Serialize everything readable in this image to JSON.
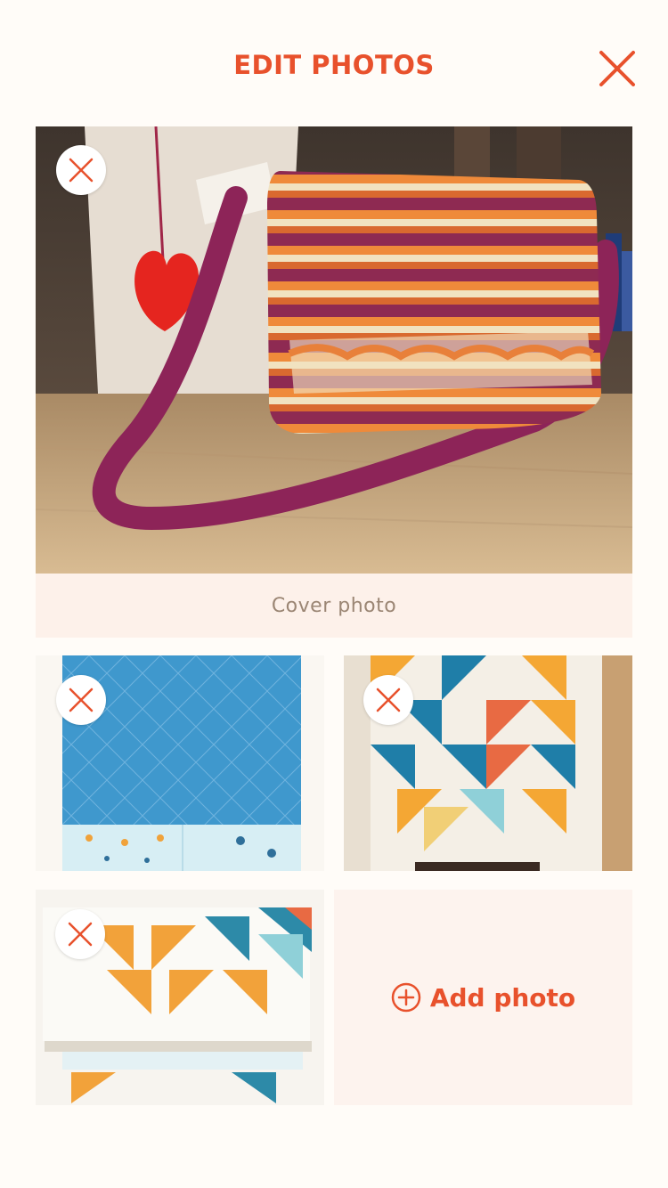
{
  "header": {
    "title": "EDIT PHOTOS",
    "close_icon": "close-icon"
  },
  "cover": {
    "label": "Cover photo",
    "remove_icon": "close-icon"
  },
  "photos": [
    {
      "name": "blue-quilt-photo",
      "remove_icon": "close-icon"
    },
    {
      "name": "triangle-quilt-photo",
      "remove_icon": "close-icon"
    },
    {
      "name": "folded-quilt-photo",
      "remove_icon": "close-icon"
    }
  ],
  "add_photo": {
    "label": "Add photo",
    "icon": "plus-circle-icon"
  },
  "colors": {
    "accent": "#e8512c",
    "label_bg": "#fdf1ea",
    "label_text": "#9b8674"
  }
}
